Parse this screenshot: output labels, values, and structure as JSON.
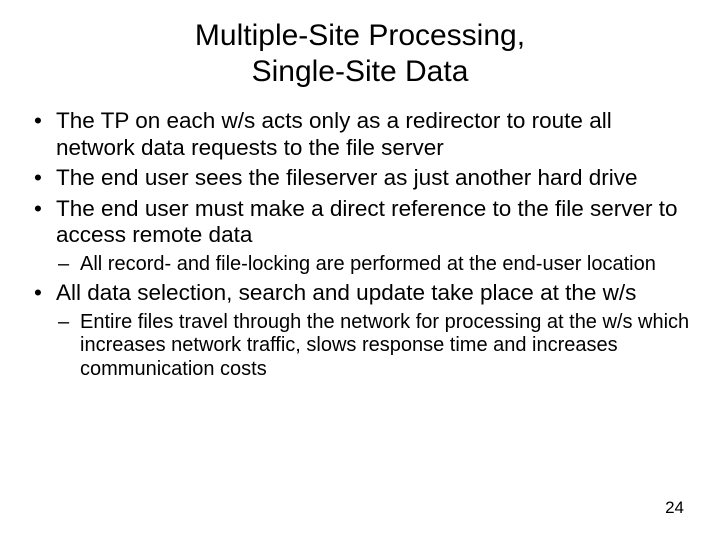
{
  "title_line1": "Multiple-Site Processing,",
  "title_line2": "Single-Site Data",
  "bullets": {
    "b1": "The TP on each w/s acts only as a redirector to route all network data requests to the file server",
    "b2": "The end user sees the fileserver as just another hard drive",
    "b3": "The end user must make a direct reference to the file server to access remote data",
    "b3_sub1": "All record- and file-locking are performed at the end-user location",
    "b4": "All data selection, search and update take place at the w/s",
    "b4_sub1": "Entire files travel through the network for processing at the w/s which increases network traffic, slows response time and increases communication costs"
  },
  "page_number": "24"
}
